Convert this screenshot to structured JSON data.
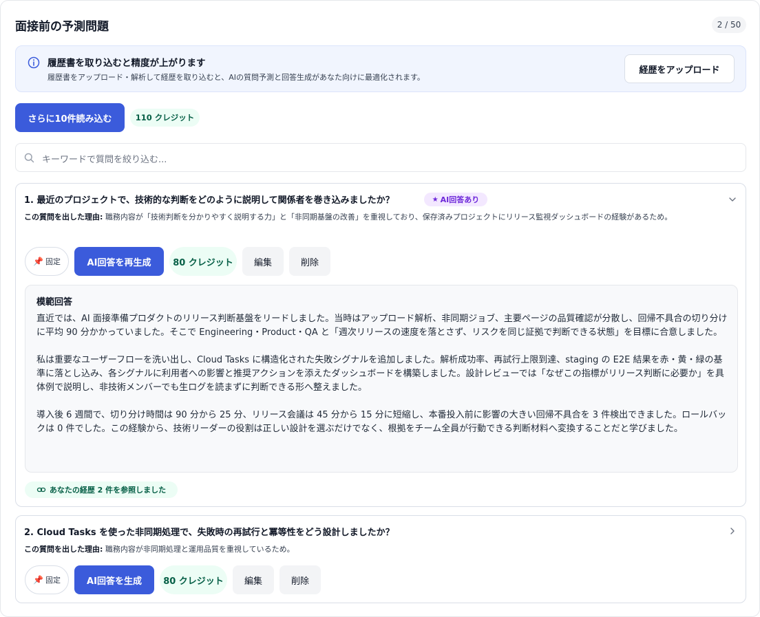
{
  "header": {
    "title": "面接前の予測問題",
    "progress": "2 / 50"
  },
  "banner": {
    "title": "履歴書を取り込むと精度が上がります",
    "description": "履歴書をアップロード・解析して経歴を取り込むと、AIの質問予測と回答生成があなた向けに最適化されます。",
    "upload_label": "経歴をアップロード",
    "icon": "info-icon"
  },
  "toolbar": {
    "load_more_label": "さらに10件読み込む",
    "credit_label": "110 クレジット"
  },
  "search": {
    "placeholder": "キーワードで質問を絞り込む..."
  },
  "questions": [
    {
      "title": "1. 最近のプロジェクトで、技術的な判断をどのように説明して関係者を巻き込みましたか？",
      "badge": "AI回答あり",
      "expanded": true,
      "reason_label": "この質問を出した理由:",
      "reason_text": " 職務内容が「技術判断を分かりやすく説明する力」と「非同期基盤の改善」を重視しており、保存済みプロジェクトにリリース監視ダッシュボードの経験があるため。",
      "pin_label": "固定",
      "generate_label": "AI回答を再生成",
      "credit_label": "80 クレジット",
      "edit_label": "編集",
      "delete_label": "削除",
      "answer": {
        "title": "模範回答",
        "paragraphs": [
          "直近では、AI 面接準備プロダクトのリリース判断基盤をリードしました。当時はアップロード解析、非同期ジョブ、主要ページの品質確認が分散し、回帰不具合の切り分けに平均 90 分かかっていました。そこで Engineering・Product・QA と「週次リリースの速度を落とさず、リスクを同じ証拠で判断できる状態」を目標に合意しました。",
          "私は重要なユーザーフローを洗い出し、Cloud Tasks に構造化された失敗シグナルを追加しました。解析成功率、再試行上限到達、staging の E2E 結果を赤・黄・緑の基準に落とし込み、各シグナルに利用者への影響と推奨アクションを添えたダッシュボードを構築しました。設計レビューでは「なぜこの指標がリリース判断に必要か」を具体例で説明し、非技術メンバーでも生ログを読まずに判断できる形へ整えました。",
          "導入後 6 週間で、切り分け時間は 90 分から 25 分、リリース会議は 45 分から 15 分に短縮し、本番投入前に影響の大きい回帰不具合を 3 件検出できました。ロールバックは 0 件でした。この経験から、技術リーダーの役割は正しい設計を選ぶだけでなく、根拠をチーム全員が行動できる判断材料へ変換することだと学びました。"
        ]
      },
      "reference_label": "あなたの経歴 2 件を参照しました"
    },
    {
      "title": "2. Cloud Tasks を使った非同期処理で、失敗時の再試行と冪等性をどう設計しましたか？",
      "expanded": false,
      "reason_label": "この質問を出した理由:",
      "reason_text": " 職務内容が非同期処理と運用品質を重視しているため。",
      "pin_label": "固定",
      "generate_label": "AI回答を生成",
      "credit_label": "80 クレジット",
      "edit_label": "編集",
      "delete_label": "削除"
    }
  ],
  "colors": {
    "primary": "#3b5bdb",
    "credit_bg": "#ecfdf5",
    "credit_text": "#065f46",
    "badge_bg": "#f3e8ff",
    "badge_text": "#6d28d9",
    "banner_bg": "#f1f5fe"
  }
}
